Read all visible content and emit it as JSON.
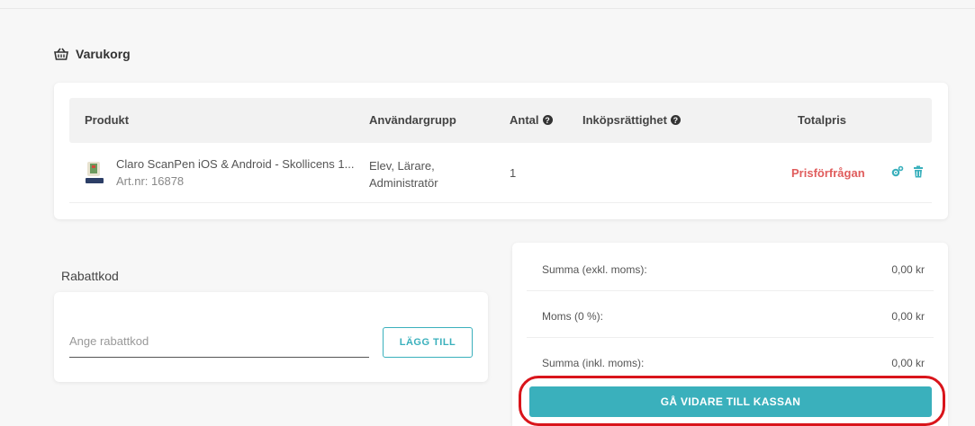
{
  "cart": {
    "title": "Varukorg",
    "columns": {
      "product": "Produkt",
      "user_group": "Användargrupp",
      "quantity": "Antal",
      "purchase_right": "Inköpsrättighet",
      "total_price": "Totalpris"
    },
    "items": [
      {
        "name": "Claro ScanPen iOS & Android - Skollicens 1...",
        "article": "Art.nr: 16878",
        "user_group_line1": "Elev, Lärare,",
        "user_group_line2": "Administratör",
        "quantity": "1",
        "purchase_right": "",
        "price": "Prisförfrågan"
      }
    ]
  },
  "discount": {
    "label": "Rabattkod",
    "placeholder": "Ange rabattkod",
    "button": "LÄGG TILL"
  },
  "summary": {
    "rows": [
      {
        "label": "Summa (exkl. moms):",
        "value": "0,00 kr"
      },
      {
        "label": "Moms (0 %):",
        "value": "0,00 kr"
      },
      {
        "label": "Summa (inkl. moms):",
        "value": "0,00 kr"
      }
    ],
    "checkout_button": "GÅ VIDARE TILL KASSAN"
  },
  "colors": {
    "accent": "#3ab0bc",
    "price_request": "#e05c5c",
    "highlight_outline": "#d9151b"
  },
  "icons": [
    "basket-icon",
    "question-icon",
    "cogs-icon",
    "trash-icon"
  ]
}
